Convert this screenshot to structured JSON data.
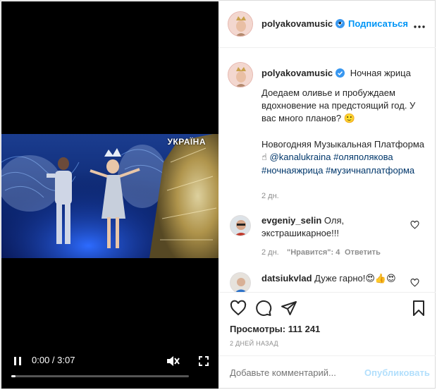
{
  "player": {
    "channel_logo": "УКРАЇНА",
    "time_text": "0:00 / 3:07",
    "progress_fraction": 0.0,
    "icons": [
      "pause-icon",
      "volume-muted-icon",
      "fullscreen-icon"
    ]
  },
  "header": {
    "username": "polyakovamusic",
    "separator": "•",
    "follow_label": "Подписаться"
  },
  "caption": {
    "username": "polyakovamusic",
    "title": "Ночная жрица",
    "line1": "Доедаем оливье и пробуждаем вдохновение на предстоящий год. У вас много планов?",
    "emoji1": "🙂",
    "line2a": "Новогодняя Музыкальная Платформа",
    "emoji2": "☝",
    "mention": "@kanalukraina",
    "tags": "#оляполякова #ночнаяжрица #музичнаплатформа",
    "age": "2 дн."
  },
  "comments": [
    {
      "username": "evgeniy_selin",
      "text": "Оля, экстрашикарное!!!",
      "age": "2 дн.",
      "likes": "\"Нравится\": 4",
      "reply": "Ответить"
    },
    {
      "username": "datsiukvlad",
      "text": "Дуже гарно!",
      "emojis": "😍👍😍"
    }
  ],
  "actions": {
    "views_label": "Просмотры:",
    "views_value": "111 241",
    "date": "2 дней назад"
  },
  "composer": {
    "placeholder": "Добавьте комментарий...",
    "publish_label": "Опубликовать"
  },
  "colors": {
    "accent": "#0095f6",
    "verified": "#3897f0",
    "link": "#00376b",
    "muted": "#8e8e8e",
    "publish_disabled": "#b2dffc"
  }
}
